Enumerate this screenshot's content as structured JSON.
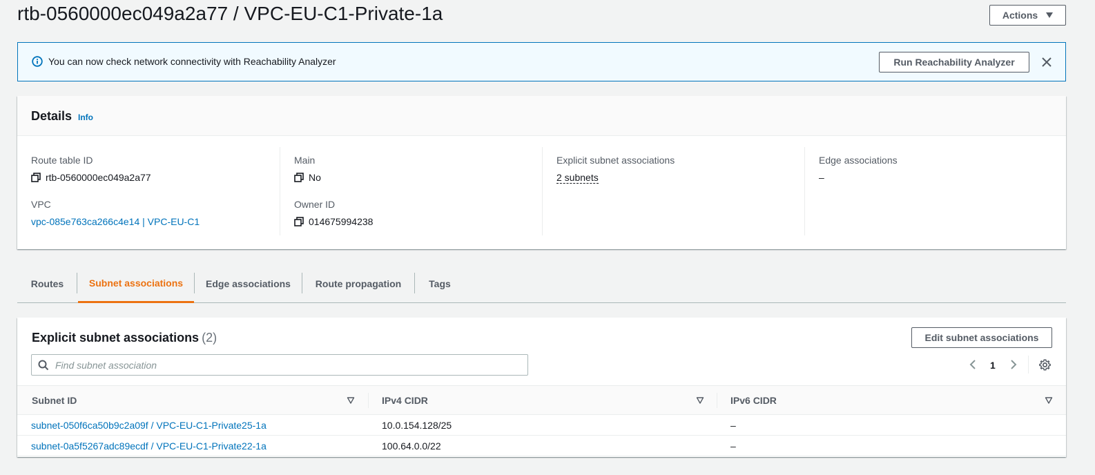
{
  "header": {
    "title": "rtb-0560000ec049a2a77 / VPC-EU-C1-Private-1a",
    "actions_label": "Actions"
  },
  "flash": {
    "message": "You can now check network connectivity with Reachability Analyzer",
    "button_label": "Run Reachability Analyzer"
  },
  "details": {
    "title": "Details",
    "info": "Info",
    "route_table_id_label": "Route table ID",
    "route_table_id": "rtb-0560000ec049a2a77",
    "vpc_label": "VPC",
    "vpc": "vpc-085e763ca266c4e14 | VPC-EU-C1",
    "main_label": "Main",
    "main": "No",
    "owner_id_label": "Owner ID",
    "owner_id": "014675994238",
    "explicit_label": "Explicit subnet associations",
    "explicit_value": "2 subnets",
    "edge_label": "Edge associations",
    "edge_value": "–"
  },
  "tabs": [
    {
      "label": "Routes",
      "active": false
    },
    {
      "label": "Subnet associations",
      "active": true
    },
    {
      "label": "Edge associations",
      "active": false
    },
    {
      "label": "Route propagation",
      "active": false
    },
    {
      "label": "Tags",
      "active": false
    }
  ],
  "subnet_table": {
    "title": "Explicit subnet associations",
    "count": "(2)",
    "edit_label": "Edit subnet associations",
    "search_placeholder": "Find subnet association",
    "page": "1",
    "columns": [
      "Subnet ID",
      "IPv4 CIDR",
      "IPv6 CIDR"
    ],
    "rows": [
      {
        "subnet": "subnet-050f6ca50b9c2a09f / VPC-EU-C1-Private25-1a",
        "ipv4": "10.0.154.128/25",
        "ipv6": "–"
      },
      {
        "subnet": "subnet-0a5f5267adc89ecdf / VPC-EU-C1-Private22-1a",
        "ipv4": "100.64.0.0/22",
        "ipv6": "–"
      }
    ]
  },
  "colors": {
    "link": "#0073bb",
    "active_tab": "#ec7211",
    "flash_bg": "#f1faff",
    "flash_border": "#0073bb"
  }
}
